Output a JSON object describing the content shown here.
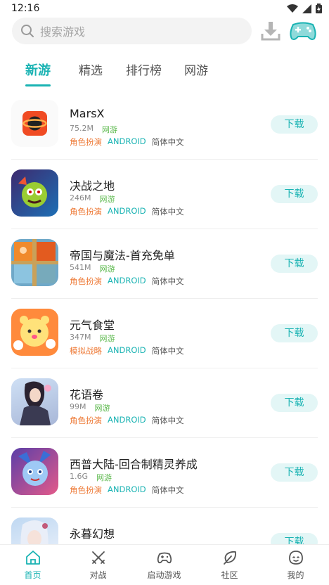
{
  "status": {
    "time": "12:16"
  },
  "search": {
    "placeholder": "搜索游戏"
  },
  "tabs": [
    {
      "label": "新游",
      "active": true
    },
    {
      "label": "精选",
      "active": false
    },
    {
      "label": "排行榜",
      "active": false
    },
    {
      "label": "网游",
      "active": false
    }
  ],
  "apps": [
    {
      "name": "MarsX",
      "size": "75.2M",
      "type": "网游",
      "genre": "角色扮演",
      "platform": "ANDROID",
      "lang": "简体中文",
      "button": "下载"
    },
    {
      "name": "决战之地",
      "size": "246M",
      "type": "网游",
      "genre": "角色扮演",
      "platform": "ANDROID",
      "lang": "简体中文",
      "button": "下载"
    },
    {
      "name": "帝国与魔法-首充免单",
      "size": "541M",
      "type": "网游",
      "genre": "角色扮演",
      "platform": "ANDROID",
      "lang": "简体中文",
      "button": "下载"
    },
    {
      "name": "元气食堂",
      "size": "347M",
      "type": "网游",
      "genre": "模拟战略",
      "platform": "ANDROID",
      "lang": "简体中文",
      "button": "下载"
    },
    {
      "name": "花语卷",
      "size": "99M",
      "type": "网游",
      "genre": "角色扮演",
      "platform": "ANDROID",
      "lang": "简体中文",
      "button": "下载"
    },
    {
      "name": "西普大陆-回合制精灵养成",
      "size": "1.6G",
      "type": "网游",
      "genre": "角色扮演",
      "platform": "ANDROID",
      "lang": "简体中文",
      "button": "下载"
    },
    {
      "name": "永暮幻想",
      "size": "",
      "type": "",
      "genre": "",
      "platform": "",
      "lang": "",
      "button": "下载"
    }
  ],
  "nav": [
    {
      "label": "首页",
      "icon": "home-icon",
      "active": true
    },
    {
      "label": "对战",
      "icon": "swords-icon",
      "active": false
    },
    {
      "label": "启动游戏",
      "icon": "gamepad-icon",
      "active": false
    },
    {
      "label": "社区",
      "icon": "leaf-icon",
      "active": false
    },
    {
      "label": "我的",
      "icon": "face-icon",
      "active": false
    }
  ],
  "colors": {
    "accent": "#1ab3b3",
    "genre": "#ee7a37",
    "net": "#5ab84b"
  }
}
